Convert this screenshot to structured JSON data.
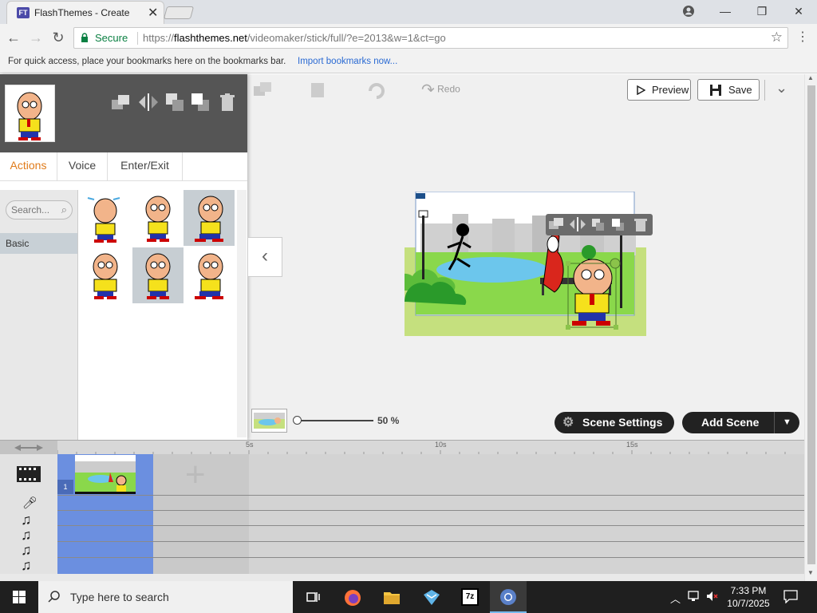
{
  "browser": {
    "tab_title": "FlashThemes - Create",
    "tab_favicon": "FT",
    "secure_label": "Secure",
    "url_scheme": "https://",
    "url_host": "flashthemes.net",
    "url_path": "/videomaker/stick/full/?e=2013&w=1&ct=go",
    "bookmarks_hint": "For quick access, place your bookmarks here on the bookmarks bar.",
    "bookmarks_link": "Import bookmarks now..."
  },
  "panel": {
    "tabs": [
      {
        "label": "Actions"
      },
      {
        "label": "Voice"
      },
      {
        "label": "Enter/Exit"
      }
    ],
    "search_placeholder": "Search...",
    "category": "Basic"
  },
  "toolbar": {
    "redo_label": "Redo",
    "preview_label": "Preview",
    "save_label": "Save"
  },
  "bottom": {
    "zoom_label": "50 %",
    "scene_settings_label": "Scene Settings",
    "add_scene_label": "Add Scene"
  },
  "timeline": {
    "tick_labels": [
      "5s",
      "10s",
      "15s"
    ],
    "scene_number": "1"
  },
  "taskbar": {
    "search_placeholder": "Type here to search",
    "time": "7:33 PM",
    "date": "10/7/2025"
  },
  "colors": {
    "accent_orange": "#e07b1a",
    "timeline_blue": "#6b8fe0",
    "secure_green": "#0b8043",
    "link_blue": "#2a6ad3"
  }
}
